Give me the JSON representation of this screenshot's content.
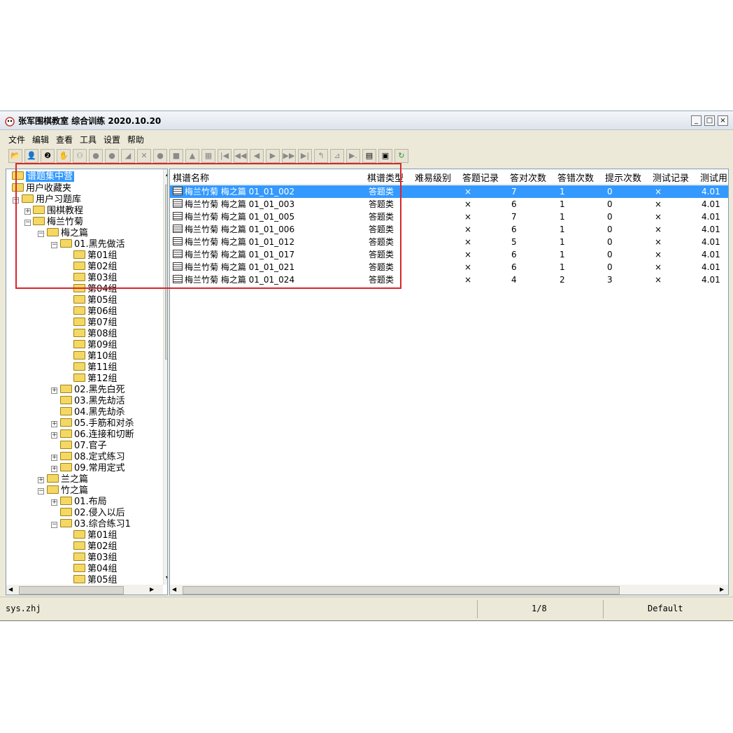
{
  "window": {
    "title": "张军围棋教室 综合训练 2020.10.20",
    "buttons": [
      "_",
      "□",
      "×"
    ]
  },
  "menu": [
    "文件",
    "编辑",
    "查看",
    "工具",
    "设置",
    "帮助"
  ],
  "toolbar": [
    "📂",
    "👤",
    "❷",
    "✋",
    "⚇",
    "●",
    "●",
    "◢",
    "✕",
    "●",
    "■",
    "▲",
    "▦",
    "|◀",
    "◀◀",
    "◀",
    "▶",
    "▶▶",
    "▶|",
    "↰",
    "⊿",
    "▶.",
    "▤",
    "▣",
    "↻"
  ],
  "tree": {
    "root": "谱题集中营",
    "items": [
      {
        "label": "用户收藏夹"
      },
      {
        "label": "用户习题库"
      },
      {
        "label": "围棋教程"
      },
      {
        "label": "梅兰竹菊"
      },
      {
        "label": "梅之篇"
      },
      {
        "label": "01.黑先做活"
      },
      {
        "label": "第01组"
      },
      {
        "label": "第02组"
      },
      {
        "label": "第03组"
      },
      {
        "label": "第04组"
      },
      {
        "label": "第05组"
      },
      {
        "label": "第06组"
      },
      {
        "label": "第07组"
      },
      {
        "label": "第08组"
      },
      {
        "label": "第09组"
      },
      {
        "label": "第10组"
      },
      {
        "label": "第11组"
      },
      {
        "label": "第12组"
      },
      {
        "label": "02.黑先白死"
      },
      {
        "label": "03.黑先劫活"
      },
      {
        "label": "04.黑先劫杀"
      },
      {
        "label": "05.手筋和对杀"
      },
      {
        "label": "06.连接和切断"
      },
      {
        "label": "07.官子"
      },
      {
        "label": "08.定式练习"
      },
      {
        "label": "09.常用定式"
      },
      {
        "label": "兰之篇"
      },
      {
        "label": "竹之篇"
      },
      {
        "label": "01.布局"
      },
      {
        "label": "02.侵入以后"
      },
      {
        "label": "03.综合练习1"
      },
      {
        "label": "第01组"
      },
      {
        "label": "第02组"
      },
      {
        "label": "第03组"
      },
      {
        "label": "第04组"
      },
      {
        "label": "第05组"
      }
    ]
  },
  "list": {
    "headers": [
      "棋谱名称",
      "棋谱类型",
      "难易级别",
      "答题记录",
      "答对次数",
      "答错次数",
      "提示次数",
      "测试记录",
      "测试用"
    ],
    "rows": [
      {
        "name": "梅兰竹菊 梅之篇 01_01_002",
        "type": "答题类",
        "record": "×",
        "right": "7",
        "wrong": "1",
        "hint": "0",
        "test": "×",
        "time": "4.01"
      },
      {
        "name": "梅兰竹菊 梅之篇 01_01_003",
        "type": "答题类",
        "record": "×",
        "right": "6",
        "wrong": "1",
        "hint": "0",
        "test": "×",
        "time": "4.01"
      },
      {
        "name": "梅兰竹菊 梅之篇 01_01_005",
        "type": "答题类",
        "record": "×",
        "right": "7",
        "wrong": "1",
        "hint": "0",
        "test": "×",
        "time": "4.01"
      },
      {
        "name": "梅兰竹菊 梅之篇 01_01_006",
        "type": "答题类",
        "record": "×",
        "right": "6",
        "wrong": "1",
        "hint": "0",
        "test": "×",
        "time": "4.01"
      },
      {
        "name": "梅兰竹菊 梅之篇 01_01_012",
        "type": "答题类",
        "record": "×",
        "right": "5",
        "wrong": "1",
        "hint": "0",
        "test": "×",
        "time": "4.01"
      },
      {
        "name": "梅兰竹菊 梅之篇 01_01_017",
        "type": "答题类",
        "record": "×",
        "right": "6",
        "wrong": "1",
        "hint": "0",
        "test": "×",
        "time": "4.01"
      },
      {
        "name": "梅兰竹菊 梅之篇 01_01_021",
        "type": "答题类",
        "record": "×",
        "right": "6",
        "wrong": "1",
        "hint": "0",
        "test": "×",
        "time": "4.01"
      },
      {
        "name": "梅兰竹菊 梅之篇 01_01_024",
        "type": "答题类",
        "record": "×",
        "right": "4",
        "wrong": "2",
        "hint": "3",
        "test": "×",
        "time": "4.01"
      }
    ]
  },
  "status": {
    "file": "sys.zhj",
    "page": "1/8",
    "profile": "Default"
  },
  "colors": {
    "selection": "#3399ff",
    "annotation": "#d9262c",
    "folder": "#f5d763"
  },
  "icons": {
    "tree_folder": "folder-icon",
    "list_item": "book-icon",
    "scroll_up": "▲",
    "scroll_down": "▼",
    "scroll_left": "◀",
    "scroll_right": "▶"
  }
}
